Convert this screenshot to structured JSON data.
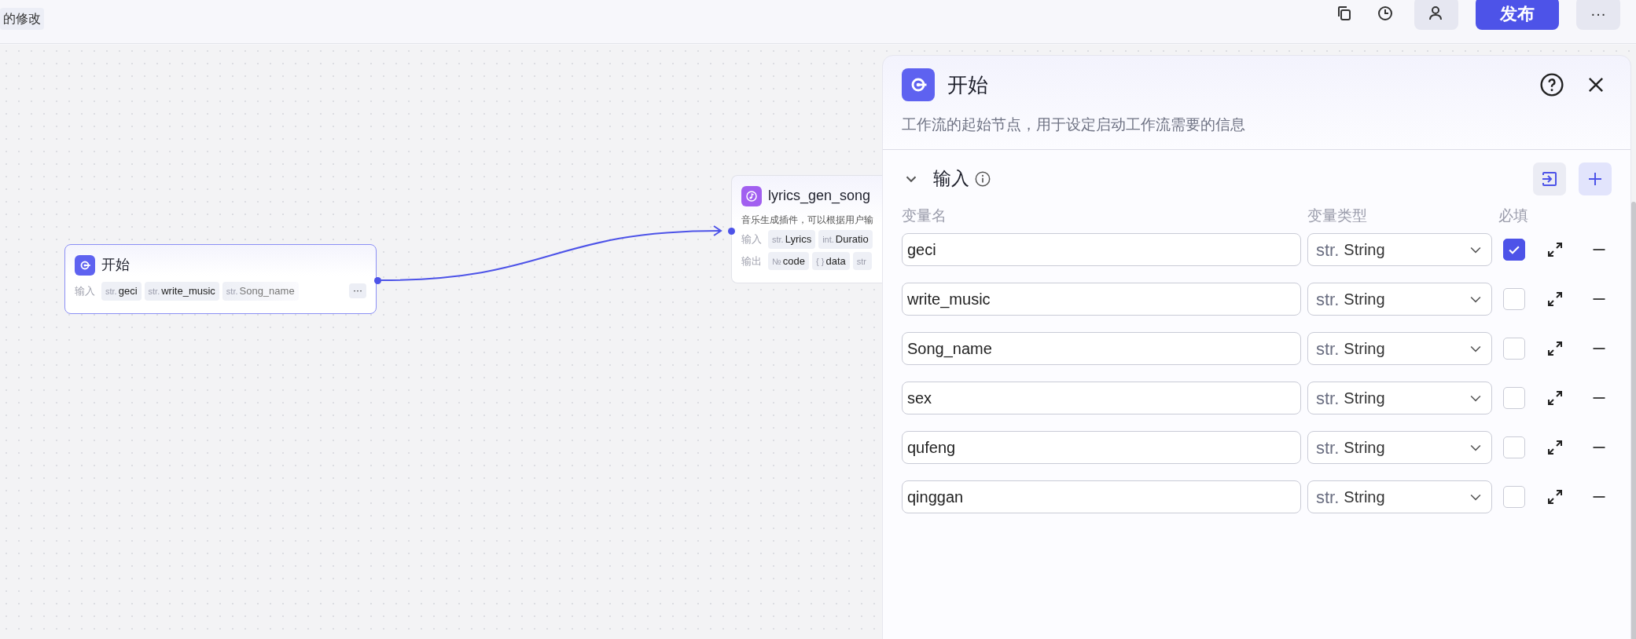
{
  "toolbar": {
    "notice": "的修改",
    "publish_button": "发布",
    "more_button": "···"
  },
  "nodes": [
    {
      "kind": "start",
      "selected": true,
      "title": "开始",
      "input_label": "输入",
      "inputs": [
        {
          "type": "str.",
          "name": "geci"
        },
        {
          "type": "str.",
          "name": "write_music"
        },
        {
          "type": "str.",
          "name": "Song_name"
        }
      ],
      "more": "···"
    },
    {
      "kind": "plugin",
      "selected": false,
      "title": "lyrics_gen_song",
      "description": "音乐生成插件，可以根据用户输",
      "input_label": "输入",
      "inputs": [
        {
          "type": "str.",
          "name": "Lyrics"
        },
        {
          "type": "int.",
          "name": "Duratio"
        }
      ],
      "output_label": "输出",
      "outputs": [
        {
          "type": "№",
          "name": "code"
        },
        {
          "type": "{ }",
          "name": "data"
        },
        {
          "type": "str"
        }
      ]
    }
  ],
  "panel": {
    "title": "开始",
    "description": "工作流的起始节点，用于设定启动工作流需要的信息",
    "section": {
      "title": "输入",
      "expanded": true
    },
    "columns": [
      "变量名",
      "变量类型",
      "必填"
    ],
    "rows": [
      {
        "name": "geci",
        "type_prefix": "str.",
        "type": "String",
        "required": true
      },
      {
        "name": "write_music",
        "type_prefix": "str.",
        "type": "String",
        "required": false
      },
      {
        "name": "Song_name",
        "type_prefix": "str.",
        "type": "String",
        "required": false
      },
      {
        "name": "sex",
        "type_prefix": "str.",
        "type": "String",
        "required": false
      },
      {
        "name": "qufeng",
        "type_prefix": "str.",
        "type": "String",
        "required": false
      },
      {
        "name": "qinggan",
        "type_prefix": "str.",
        "type": "String",
        "required": false
      }
    ]
  }
}
